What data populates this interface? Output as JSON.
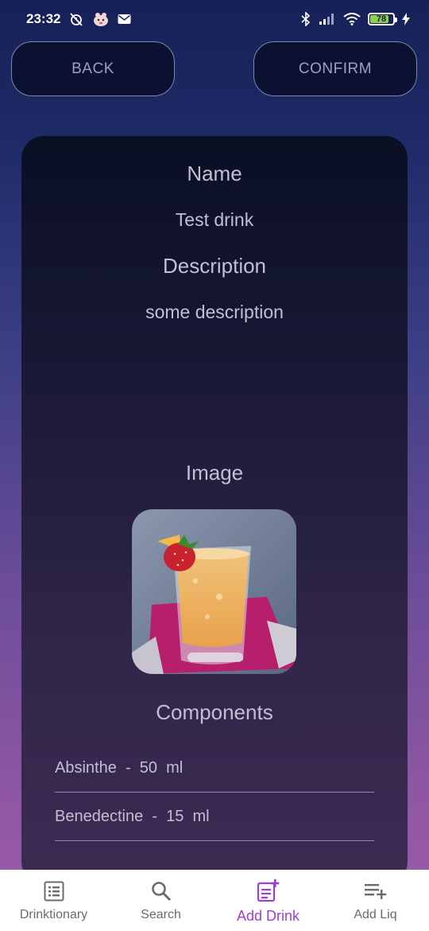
{
  "status_bar": {
    "time": "23:32",
    "battery_level": "78",
    "icons": [
      "alarm-off-icon",
      "app-notification-icon",
      "mail-icon",
      "bluetooth-icon",
      "cellular-signal-icon",
      "wifi-icon",
      "battery-icon",
      "charging-icon"
    ]
  },
  "header": {
    "back_label": "BACK",
    "confirm_label": "CONFIRM"
  },
  "form": {
    "name_label": "Name",
    "name_value": "Test drink",
    "description_label": "Description",
    "description_value": "some description",
    "image_label": "Image",
    "components_label": "Components",
    "components": [
      {
        "name": "Absinthe",
        "separator": "-",
        "amount": "50",
        "unit": "ml"
      },
      {
        "name": "Benedectine",
        "separator": "-",
        "amount": "15",
        "unit": "ml"
      }
    ]
  },
  "bottom_nav": {
    "items": [
      {
        "label": "Drinktionary",
        "icon": "list-icon",
        "active": false
      },
      {
        "label": "Search",
        "icon": "search-icon",
        "active": false
      },
      {
        "label": "Add Drink",
        "icon": "add-note-icon",
        "active": true
      },
      {
        "label": "Add Liq",
        "icon": "playlist-add-icon",
        "active": false
      }
    ]
  },
  "colors": {
    "accent": "#9b3fd6",
    "card_top": "#0a0f24",
    "card_bottom": "#3d2a52",
    "button_bg": "#0b1130"
  }
}
